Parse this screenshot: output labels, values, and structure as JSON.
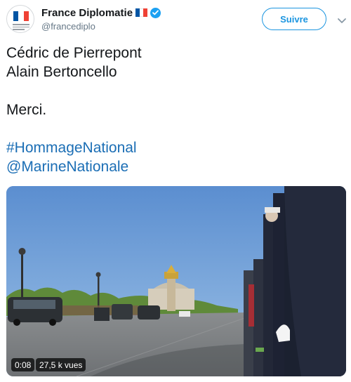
{
  "header": {
    "display_name": "France Diplomatie",
    "handle": "@francediplo",
    "follow_label": "Suivre",
    "verified_icon": "verified-badge-icon",
    "flag_icon": "france-flag-icon",
    "caret_icon": "chevron-down-icon"
  },
  "tweet": {
    "lines": [
      "Cédric de Pierrepont",
      "Alain Bertoncello",
      "Merci.",
      "#HommageNational",
      "@MarineNationale"
    ]
  },
  "video": {
    "duration": "0:08",
    "views": "27,5 k vues"
  },
  "colors": {
    "accent": "#1b95e0",
    "link": "#1b6eb5",
    "verified": "#1da1f2",
    "flag_blue": "#0055a4",
    "flag_white": "#ffffff",
    "flag_red": "#ef4135"
  }
}
